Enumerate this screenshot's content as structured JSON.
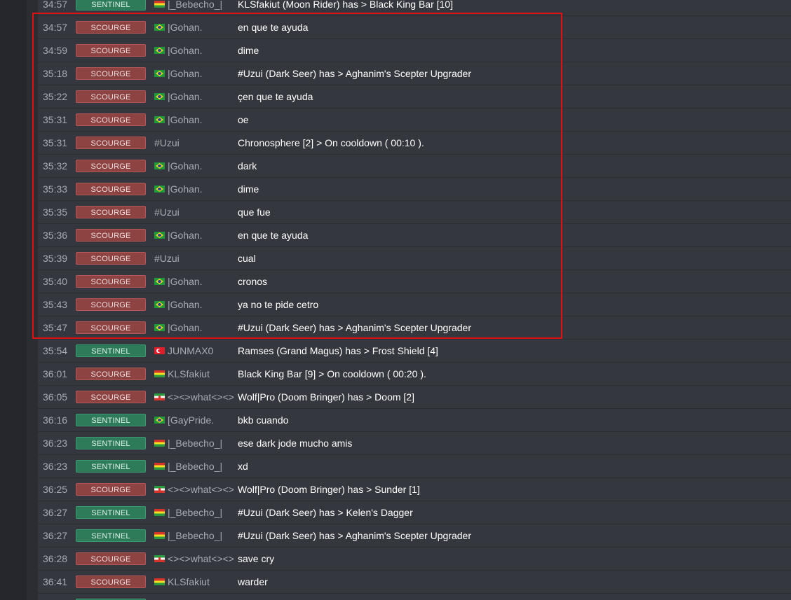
{
  "colors": {
    "scourge_badge": "#8e4343",
    "sentinel_badge": "#2e7b5a",
    "highlight_border": "#e01010"
  },
  "rows": [
    {
      "time": "34:57",
      "team": "SENTINEL",
      "flag": "bo",
      "player": "|_Bebecho_|",
      "message": "KLSfakiut (Moon Rider) has > Black King Bar [10]"
    },
    {
      "time": "34:57",
      "team": "SCOURGE",
      "flag": "br",
      "player": "|Gohan.",
      "message": "en que te ayuda"
    },
    {
      "time": "34:59",
      "team": "SCOURGE",
      "flag": "br",
      "player": "|Gohan.",
      "message": "dime"
    },
    {
      "time": "35:18",
      "team": "SCOURGE",
      "flag": "br",
      "player": "|Gohan.",
      "message": "#Uzui (Dark Seer) has > Aghanim's Scepter Upgrader"
    },
    {
      "time": "35:22",
      "team": "SCOURGE",
      "flag": "br",
      "player": "|Gohan.",
      "message": "çen que te ayuda"
    },
    {
      "time": "35:31",
      "team": "SCOURGE",
      "flag": "br",
      "player": "|Gohan.",
      "message": "oe"
    },
    {
      "time": "35:31",
      "team": "SCOURGE",
      "flag": "",
      "player": "#Uzui",
      "message": "Chronosphere [2] > On cooldown ( 00:10 )."
    },
    {
      "time": "35:32",
      "team": "SCOURGE",
      "flag": "br",
      "player": "|Gohan.",
      "message": "dark"
    },
    {
      "time": "35:33",
      "team": "SCOURGE",
      "flag": "br",
      "player": "|Gohan.",
      "message": "dime"
    },
    {
      "time": "35:35",
      "team": "SCOURGE",
      "flag": "",
      "player": "#Uzui",
      "message": "que fue"
    },
    {
      "time": "35:36",
      "team": "SCOURGE",
      "flag": "br",
      "player": "|Gohan.",
      "message": "en que te ayuda"
    },
    {
      "time": "35:39",
      "team": "SCOURGE",
      "flag": "",
      "player": "#Uzui",
      "message": "cual"
    },
    {
      "time": "35:40",
      "team": "SCOURGE",
      "flag": "br",
      "player": "|Gohan.",
      "message": "cronos"
    },
    {
      "time": "35:43",
      "team": "SCOURGE",
      "flag": "br",
      "player": "|Gohan.",
      "message": "ya no te pide cetro"
    },
    {
      "time": "35:47",
      "team": "SCOURGE",
      "flag": "br",
      "player": "|Gohan.",
      "message": "#Uzui (Dark Seer) has > Aghanim's Scepter Upgrader"
    },
    {
      "time": "35:54",
      "team": "SENTINEL",
      "flag": "tr",
      "player": "JUNMAX0",
      "message": "Ramses (Grand Magus) has > Frost Shield [4]"
    },
    {
      "time": "36:01",
      "team": "SCOURGE",
      "flag": "bo",
      "player": "KLSfakiut",
      "message": "Black King Bar [9] > On cooldown ( 00:20 )."
    },
    {
      "time": "36:05",
      "team": "SCOURGE",
      "flag": "ir",
      "player": "<><>what<><>",
      "message": "Wolf|Pro (Doom Bringer) has > Doom [2]"
    },
    {
      "time": "36:16",
      "team": "SENTINEL",
      "flag": "br",
      "player": "[GayPride.",
      "message": "bkb cuando"
    },
    {
      "time": "36:23",
      "team": "SENTINEL",
      "flag": "bo",
      "player": "|_Bebecho_|",
      "message": "ese dark jode mucho amis"
    },
    {
      "time": "36:23",
      "team": "SENTINEL",
      "flag": "bo",
      "player": "|_Bebecho_|",
      "message": "xd"
    },
    {
      "time": "36:25",
      "team": "SCOURGE",
      "flag": "ir",
      "player": "<><>what<><>",
      "message": "Wolf|Pro (Doom Bringer) has > Sunder [1]"
    },
    {
      "time": "36:27",
      "team": "SENTINEL",
      "flag": "bo",
      "player": "|_Bebecho_|",
      "message": "#Uzui (Dark Seer) has > Kelen's Dagger"
    },
    {
      "time": "36:27",
      "team": "SENTINEL",
      "flag": "bo",
      "player": "|_Bebecho_|",
      "message": "#Uzui (Dark Seer) has > Aghanim's Scepter Upgrader"
    },
    {
      "time": "36:28",
      "team": "SCOURGE",
      "flag": "ir",
      "player": "<><>what<><>",
      "message": "save cry"
    },
    {
      "time": "36:41",
      "team": "SCOURGE",
      "flag": "bo",
      "player": "KLSfakiut",
      "message": "warder"
    },
    {
      "time": "",
      "team": "SENTINEL",
      "flag": "",
      "player": "",
      "message": ""
    }
  ]
}
